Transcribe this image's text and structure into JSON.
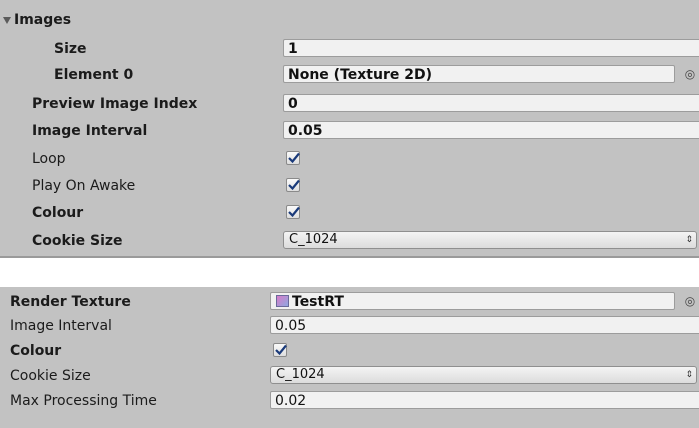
{
  "images_section": {
    "foldout_label": "Images",
    "size_label": "Size",
    "size_value": "1",
    "element0_label": "Element 0",
    "element0_value": "None (Texture 2D)",
    "preview_index_label": "Preview Image Index",
    "preview_index_value": "0",
    "image_interval_label": "Image Interval",
    "image_interval_value": "0.05",
    "loop_label": "Loop",
    "loop_checked": true,
    "play_on_awake_label": "Play On Awake",
    "play_on_awake_checked": true,
    "colour_label": "Colour",
    "colour_checked": true,
    "cookie_size_label": "Cookie Size",
    "cookie_size_value": "C_1024"
  },
  "render_section": {
    "render_texture_label": "Render Texture",
    "render_texture_value": "TestRT",
    "image_interval_label": "Image Interval",
    "image_interval_value": "0.05",
    "colour_label": "Colour",
    "colour_checked": true,
    "cookie_size_label": "Cookie Size",
    "cookie_size_value": "C_1024",
    "max_processing_label": "Max Processing Time",
    "max_processing_value": "0.02"
  },
  "icons": {
    "object_picker": "◎",
    "dropdown_arrows": "⇕"
  }
}
